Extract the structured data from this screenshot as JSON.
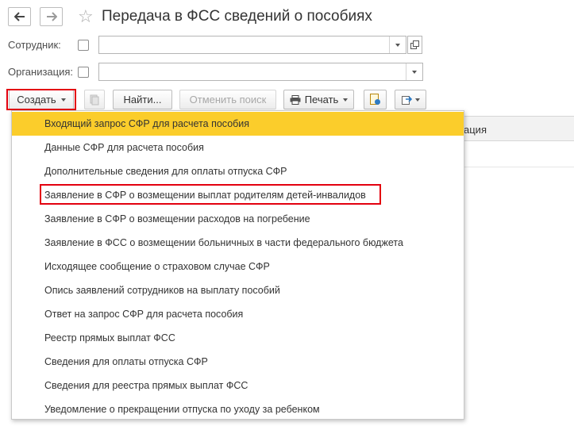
{
  "window": {
    "title": "Передача в ФСС сведений о пособиях"
  },
  "filters": {
    "employee_label": "Сотрудник:",
    "employee_value": "",
    "organization_label": "Организация:",
    "organization_value": ""
  },
  "toolbar": {
    "create_label": "Создать",
    "find_label": "Найти...",
    "cancel_search_label": "Отменить поиск",
    "print_label": "Печать"
  },
  "table": {
    "partial_header": "ация"
  },
  "create_menu": {
    "items": [
      "Входящий запрос СФР для расчета пособия",
      "Данные СФР для расчета пособия",
      "Дополнительные сведения для оплаты отпуска СФР",
      "Заявление в СФР о возмещении выплат родителям детей-инвалидов",
      "Заявление в СФР о возмещении расходов на погребение",
      "Заявление в ФСС о возмещении больничных в части федерального бюджета",
      "Исходящее сообщение о страховом случае СФР",
      "Опись заявлений сотрудников на выплату пособий",
      "Ответ на запрос СФР для расчета пособия",
      "Реестр прямых выплат ФСС",
      "Сведения для оплаты отпуска СФР",
      "Сведения для реестра прямых выплат ФСС",
      "Уведомление о прекращении отпуска по уходу за ребенком"
    ],
    "highlighted_index": 0,
    "framed_index": 3
  },
  "colors": {
    "highlight": "#fbcd2b",
    "annotation_frame": "#e3000f"
  },
  "icons": [
    "back-arrow-icon",
    "forward-arrow-icon",
    "favorite-star-icon",
    "open-form-icon",
    "copy-icon",
    "printer-icon",
    "report-icon",
    "export-icon"
  ]
}
